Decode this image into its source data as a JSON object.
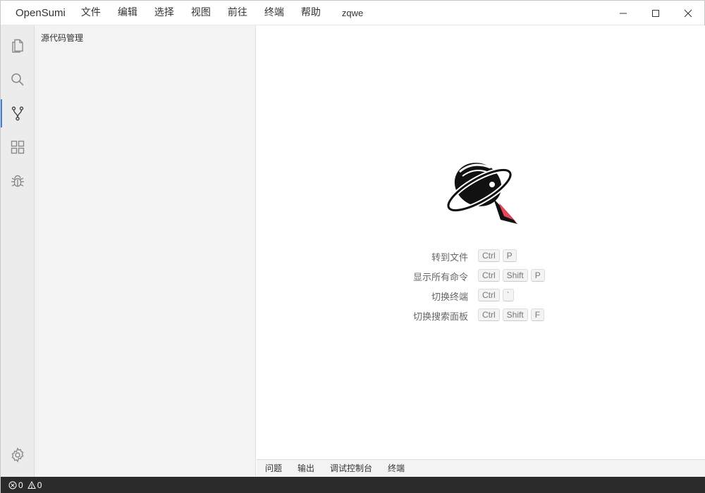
{
  "app": {
    "name": "OpenSumi",
    "window_title": "zqwe"
  },
  "menu": {
    "items": [
      {
        "label": "文件"
      },
      {
        "label": "编辑"
      },
      {
        "label": "选择"
      },
      {
        "label": "视图"
      },
      {
        "label": "前往"
      },
      {
        "label": "终端"
      },
      {
        "label": "帮助"
      }
    ]
  },
  "window_controls": [
    "minimize-icon",
    "maximize-icon",
    "close-icon"
  ],
  "activity_bar": {
    "items": [
      {
        "icon": "explorer-files-icon",
        "active": false
      },
      {
        "icon": "search-icon",
        "active": false
      },
      {
        "icon": "source-control-icon",
        "active": true
      },
      {
        "icon": "extensions-icon",
        "active": false
      },
      {
        "icon": "debug-icon",
        "active": false
      }
    ],
    "bottom_icon": "settings-gear-icon",
    "accent_color": "#3b82d6"
  },
  "side_panel": {
    "title": "源代码管理"
  },
  "editor": {
    "logo": "opensumi-logo",
    "shortcuts": [
      {
        "label": "转到文件",
        "keys": [
          "Ctrl",
          "P"
        ]
      },
      {
        "label": "显示所有命令",
        "keys": [
          "Ctrl",
          "Shift",
          "P"
        ]
      },
      {
        "label": "切换终端",
        "keys": [
          "Ctrl",
          "`"
        ]
      },
      {
        "label": "切换搜索面板",
        "keys": [
          "Ctrl",
          "Shift",
          "F"
        ]
      }
    ]
  },
  "bottom_panel": {
    "tabs": [
      {
        "label": "问题"
      },
      {
        "label": "输出"
      },
      {
        "label": "调试控制台"
      },
      {
        "label": "终端"
      }
    ]
  },
  "status_bar": {
    "errors": "0",
    "warnings": "0",
    "background": "#2b2b2b"
  }
}
